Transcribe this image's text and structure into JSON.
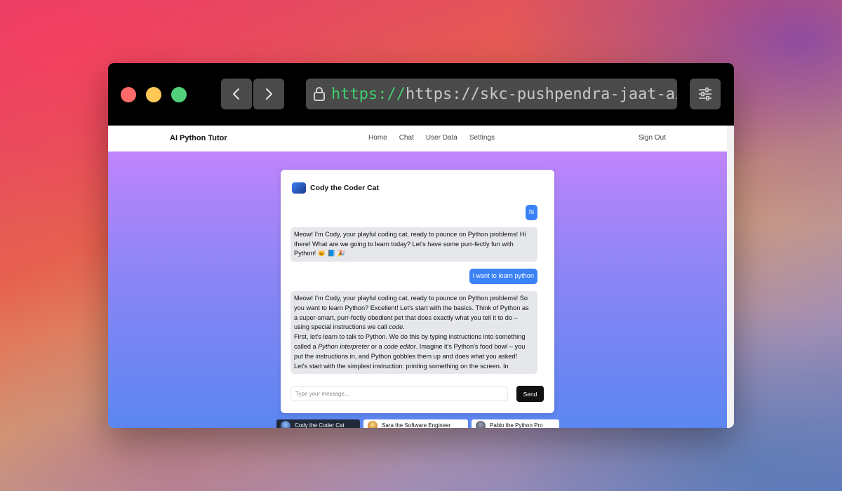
{
  "browser": {
    "url_scheme": "https://",
    "url_text": "https://skc-pushpendra-jaat-ai-python-tutor.hf.space"
  },
  "nav": {
    "brand": "AI Python Tutor",
    "links": [
      "Home",
      "Chat",
      "User Data",
      "Settings"
    ],
    "sign_out": "Sign Out"
  },
  "chat": {
    "tutor_name": "Cody the Coder Cat",
    "messages": [
      {
        "role": "user",
        "text": "hi"
      },
      {
        "role": "bot",
        "text": "Meow! I'm Cody, your playful coding cat, ready to pounce on Python problems! Hi there! What are we going to learn today? Let's have some purr-fectly fun with Python! 🐱 📘 🎉"
      },
      {
        "role": "user",
        "text": "i want to learn python"
      },
      {
        "role": "bot",
        "parts": {
          "p1": "Meow! I'm Cody, your playful coding cat, ready to pounce on Python problems! So you want to learn Python? Excellent! Let's start with the basics. Think of Python as a super-smart, purr-fectly obedient pet that does exactly what you tell it to do – using special instructions we call ",
          "p1_em": "code",
          "p1_end": ".",
          "p2_a": "First, let's learn to talk to Python. We do this by typing instructions into something called a ",
          "p2_em1": "Python interpreter",
          "p2_b": " or a ",
          "p2_em2": "code editor",
          "p2_c": ". Imagine it's Python's food bowl – you put the instructions in, and Python gobbles them up and does what you asked!",
          "p3": "Let's start with the simplest instruction: printing something on the screen. In"
        }
      }
    ],
    "input_placeholder": "Type your message...",
    "send_label": "Send"
  },
  "tutors": [
    {
      "name": "Cody the Coder Cat",
      "active": true
    },
    {
      "name": "Sara the Software Engineer",
      "active": false
    },
    {
      "name": "Pablo the Python Pro",
      "active": false
    }
  ]
}
